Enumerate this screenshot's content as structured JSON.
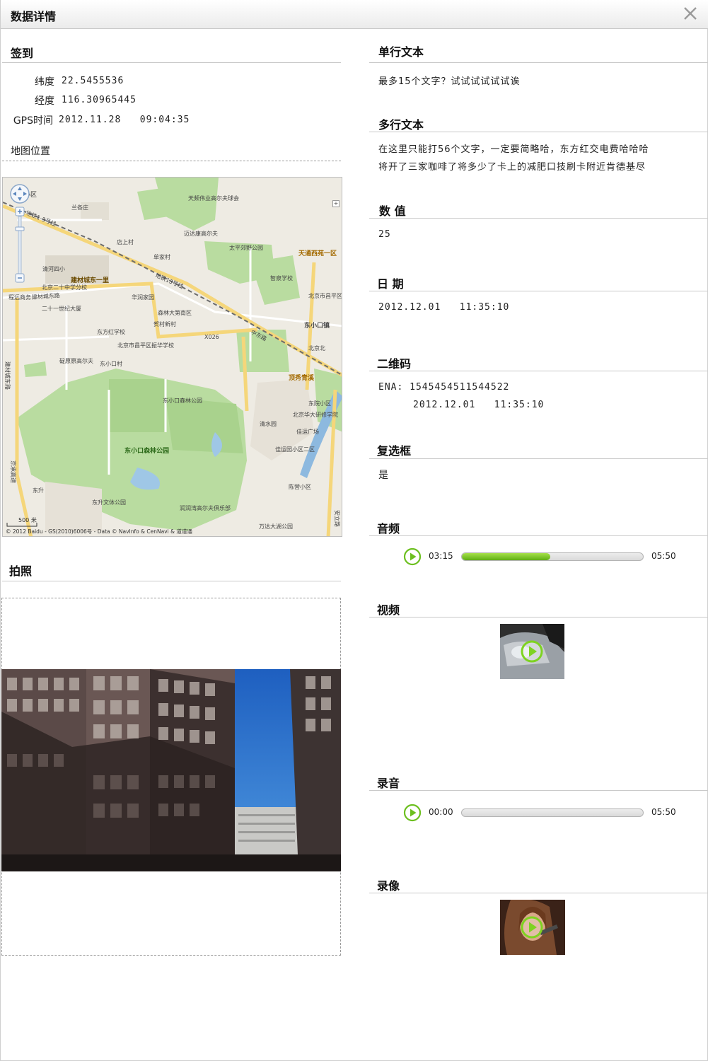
{
  "window": {
    "title": "数据详情"
  },
  "checkin": {
    "title": "签到",
    "lat_label": "纬度",
    "lat_value": "22.5455536",
    "lng_label": "经度",
    "lng_value": "116.30965445",
    "gps_label": "GPS时间",
    "gps_value": "2012.11.28   09:04:35",
    "map_title": "地图位置"
  },
  "map": {
    "labels": [
      "小区",
      "天频伟业高尔夫球会",
      "兰各庄",
      "迈达康高尔夫",
      "店上村",
      "单家村",
      "太平郊野公园",
      "天通西苑一区",
      "清河四小",
      "建材城东一里",
      "智泉学校",
      "北京二十中学分校",
      "程远商务",
      "华润家园",
      "北京市昌平区中滩中学",
      "二十一世纪大厦",
      "森林大第南区",
      "贺村新村",
      "东小口镇",
      "东方红学校",
      "X026",
      "北京市昌平区振华学校",
      "北京北",
      "碇原原高尔夫",
      "东小口村",
      "顶秀青溪",
      "东小口森林公园",
      "东院小区",
      "北京华大研修学院",
      "清水园",
      "佳运广场",
      "佳运园小区二区",
      "东小口森林公园",
      "东升",
      "陈营小区",
      "东升文体公园",
      "润润湾高尔夫俱乐部",
      "万达大湖公园",
      "安立路",
      "地铁13号线",
      "地铁1-3号线",
      "中东路",
      "建材城东路",
      "建材城东路",
      "京承高速"
    ],
    "scale": "500 米",
    "copyright": "© 2012 Baidu - GS(2010)6006号 - Data © NavInfo & CenNavi & 道道通"
  },
  "photo": {
    "title": "拍照"
  },
  "single_text": {
    "title": "单行文本",
    "value": "最多15个文字？试试试试试试诶"
  },
  "multi_text": {
    "title": "多行文本",
    "line1": "在这里只能打56个文字，一定要简略哈，东方红交电费哈哈哈",
    "line2": "将开了三家咖啡了将多少了卡上的减肥口技刷卡附近肯德基尽"
  },
  "number": {
    "title": "数 值",
    "value": "25"
  },
  "date": {
    "title": "日 期",
    "value": "2012.12.01   11:35:10"
  },
  "qrcode": {
    "title": "二维码",
    "line1": "ENA: 1545454511544522",
    "line2": "2012.12.01   11:35:10"
  },
  "checkbox": {
    "title": "复选框",
    "value": "是"
  },
  "audio": {
    "title": "音频",
    "current": "03:15",
    "total": "05:50",
    "progress": 0.49
  },
  "video": {
    "title": "视频"
  },
  "recording": {
    "title": "录音",
    "current": "00:00",
    "total": "05:50",
    "progress": 0.0
  },
  "recvideo": {
    "title": "录像"
  },
  "colors": {
    "accent_green": "#6cbf1f",
    "rule": "#c9c9c9"
  },
  "icons": {
    "close": "close-icon",
    "play": "play-icon",
    "zoom_in": "zoom-in-icon",
    "zoom_out": "zoom-out-icon",
    "pan": "pan-icon"
  }
}
